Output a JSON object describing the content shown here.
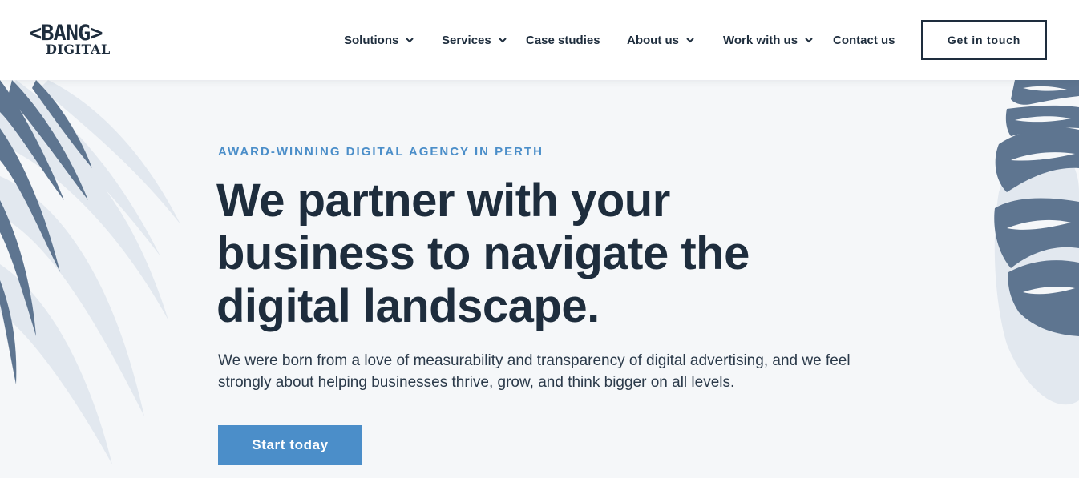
{
  "colors": {
    "navy": "#1e2d3d",
    "accent": "#4b8ec9",
    "background": "#f5f7f9",
    "palm_dark": "#5e7590",
    "palm_light": "#e2e8ef"
  },
  "logo": {
    "top": "<BANG>",
    "bottom": "DIGITAL"
  },
  "nav": {
    "items": [
      {
        "label": "Solutions",
        "has_dropdown": true
      },
      {
        "label": "Services",
        "has_dropdown": true
      },
      {
        "label": "Case studies",
        "has_dropdown": false
      },
      {
        "label": "About us",
        "has_dropdown": true
      },
      {
        "label": "Work with us",
        "has_dropdown": true
      },
      {
        "label": "Contact us",
        "has_dropdown": false
      }
    ],
    "cta_label": "Get in touch"
  },
  "hero": {
    "eyebrow": "AWARD-WINNING DIGITAL AGENCY IN PERTH",
    "headline": "We partner with your business to navigate the digital landscape.",
    "subtext": "We were born from a love of measurability and transparency of digital advertising, and we feel strongly about helping businesses thrive, grow, and think bigger on all levels.",
    "button_label": "Start today"
  },
  "icons": {
    "dropdown": "chevron-down-icon",
    "left_art": "palm-leaf-art",
    "right_art": "monstera-leaf-art"
  }
}
